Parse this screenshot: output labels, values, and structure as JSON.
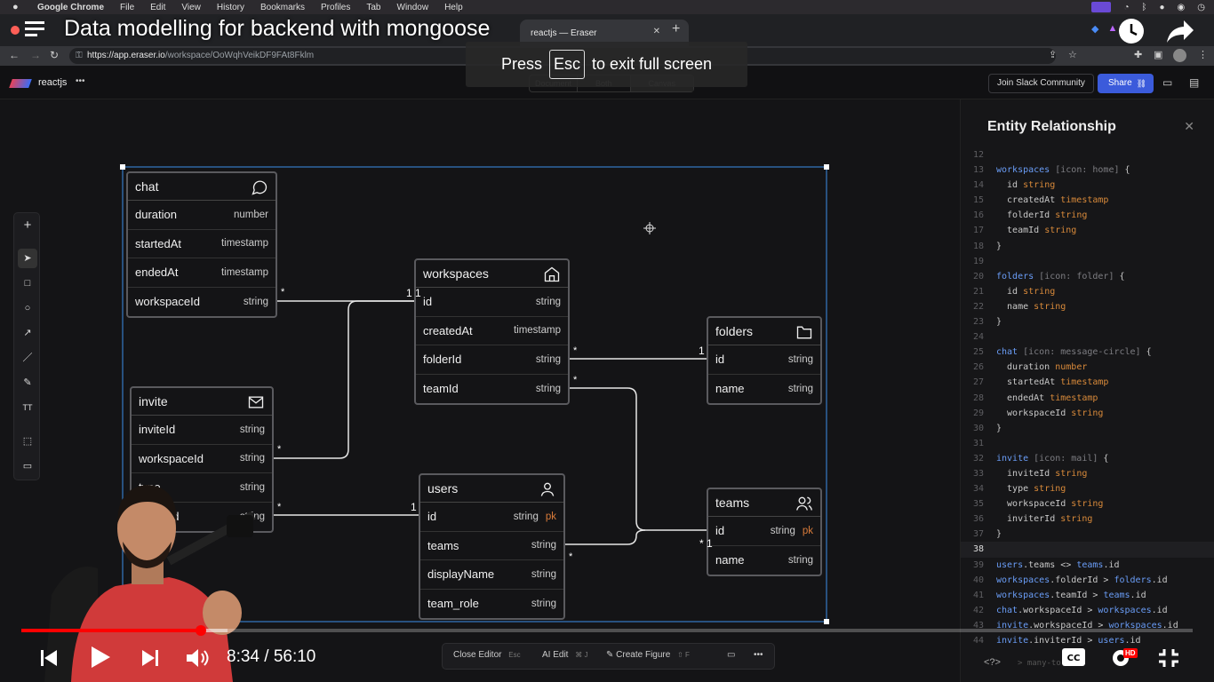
{
  "menubar": {
    "app": "Google Chrome",
    "items": [
      "File",
      "Edit",
      "View",
      "History",
      "Bookmarks",
      "Profiles",
      "Tab",
      "Window",
      "Help"
    ]
  },
  "video": {
    "title": "Data modelling for backend with mongoose",
    "esc_before": "Press",
    "esc_key": "Esc",
    "esc_after": "to exit full screen",
    "time_current": "8:34",
    "time_total": "56:10",
    "played_fraction": 0.153,
    "quality_badge": "HD"
  },
  "browser": {
    "tabs": [
      {
        "label": "reactjs — Eraser",
        "active": true
      }
    ],
    "url_host": "https://app.eraser.io",
    "url_path": "/workspace/OoWqhVeikDF9FAt8Fklm"
  },
  "app": {
    "workspace_name": "reactjs",
    "menu_dots": "•••",
    "views": [
      "Document",
      "Both",
      "Canvas"
    ],
    "slack_button": "Join Slack Community",
    "share_button": "Share"
  },
  "tables": {
    "chat": {
      "name": "chat",
      "icon": "message-circle-icon",
      "fields": [
        {
          "name": "duration",
          "type": "number"
        },
        {
          "name": "startedAt",
          "type": "timestamp"
        },
        {
          "name": "endedAt",
          "type": "timestamp"
        },
        {
          "name": "workspaceId",
          "type": "string"
        }
      ]
    },
    "workspaces": {
      "name": "workspaces",
      "icon": "home-icon",
      "fields": [
        {
          "name": "id",
          "type": "string"
        },
        {
          "name": "createdAt",
          "type": "timestamp"
        },
        {
          "name": "folderId",
          "type": "string"
        },
        {
          "name": "teamId",
          "type": "string"
        }
      ]
    },
    "folders": {
      "name": "folders",
      "icon": "folder-icon",
      "fields": [
        {
          "name": "id",
          "type": "string"
        },
        {
          "name": "name",
          "type": "string"
        }
      ]
    },
    "invite": {
      "name": "invite",
      "icon": "mail-icon",
      "fields": [
        {
          "name": "inviteId",
          "type": "string"
        },
        {
          "name": "workspaceId",
          "type": "string"
        },
        {
          "name": "type",
          "type": "string"
        },
        {
          "name": "inviterId",
          "type": "string"
        }
      ]
    },
    "users": {
      "name": "users",
      "icon": "user-icon",
      "fields": [
        {
          "name": "id",
          "type": "string",
          "pk": "pk"
        },
        {
          "name": "teams",
          "type": "string"
        },
        {
          "name": "displayName",
          "type": "string"
        },
        {
          "name": "team_role",
          "type": "string"
        }
      ]
    },
    "teams": {
      "name": "teams",
      "icon": "users-icon",
      "fields": [
        {
          "name": "id",
          "type": "string",
          "pk": "pk"
        },
        {
          "name": "name",
          "type": "string"
        }
      ]
    }
  },
  "cardinality": {
    "many": "*",
    "one": "1",
    "one_one": "1 1",
    "many_one": "* 1"
  },
  "panel": {
    "title": "Entity Relationship",
    "current_line": 38,
    "lines": [
      {
        "n": "12",
        "t": []
      },
      {
        "n": "13",
        "t": [
          [
            "ent",
            "workspaces"
          ],
          [
            "mut",
            " [icon: home] "
          ],
          [
            "f",
            "{"
          ]
        ]
      },
      {
        "n": "14",
        "t": [
          [
            "f",
            "  id "
          ],
          [
            "type",
            "string"
          ]
        ]
      },
      {
        "n": "15",
        "t": [
          [
            "f",
            "  createdAt "
          ],
          [
            "type",
            "timestamp"
          ]
        ]
      },
      {
        "n": "16",
        "t": [
          [
            "f",
            "  folderId "
          ],
          [
            "type",
            "string"
          ]
        ]
      },
      {
        "n": "17",
        "t": [
          [
            "f",
            "  teamId "
          ],
          [
            "type",
            "string"
          ]
        ]
      },
      {
        "n": "18",
        "t": [
          [
            "f",
            "}"
          ]
        ]
      },
      {
        "n": "19",
        "t": []
      },
      {
        "n": "20",
        "t": [
          [
            "ent",
            "folders"
          ],
          [
            "mut",
            " [icon: folder] "
          ],
          [
            "f",
            "{"
          ]
        ]
      },
      {
        "n": "21",
        "t": [
          [
            "f",
            "  id "
          ],
          [
            "type",
            "string"
          ]
        ]
      },
      {
        "n": "22",
        "t": [
          [
            "f",
            "  name "
          ],
          [
            "type",
            "string"
          ]
        ]
      },
      {
        "n": "23",
        "t": [
          [
            "f",
            "}"
          ]
        ]
      },
      {
        "n": "24",
        "t": []
      },
      {
        "n": "25",
        "t": [
          [
            "ent",
            "chat"
          ],
          [
            "mut",
            " [icon: message-circle] "
          ],
          [
            "f",
            "{"
          ]
        ]
      },
      {
        "n": "26",
        "t": [
          [
            "f",
            "  duration "
          ],
          [
            "type",
            "number"
          ]
        ]
      },
      {
        "n": "27",
        "t": [
          [
            "f",
            "  startedAt "
          ],
          [
            "type",
            "timestamp"
          ]
        ]
      },
      {
        "n": "28",
        "t": [
          [
            "f",
            "  endedAt "
          ],
          [
            "type",
            "timestamp"
          ]
        ]
      },
      {
        "n": "29",
        "t": [
          [
            "f",
            "  workspaceId "
          ],
          [
            "type",
            "string"
          ]
        ]
      },
      {
        "n": "30",
        "t": [
          [
            "f",
            "}"
          ]
        ]
      },
      {
        "n": "31",
        "t": []
      },
      {
        "n": "32",
        "t": [
          [
            "ent",
            "invite"
          ],
          [
            "mut",
            " [icon: mail] "
          ],
          [
            "f",
            "{"
          ]
        ]
      },
      {
        "n": "33",
        "t": [
          [
            "f",
            "  inviteId "
          ],
          [
            "type",
            "string"
          ]
        ]
      },
      {
        "n": "34",
        "t": [
          [
            "f",
            "  type "
          ],
          [
            "type",
            "string"
          ]
        ]
      },
      {
        "n": "35",
        "t": [
          [
            "f",
            "  workspaceId "
          ],
          [
            "type",
            "string"
          ]
        ]
      },
      {
        "n": "36",
        "t": [
          [
            "f",
            "  inviterId "
          ],
          [
            "type",
            "string"
          ]
        ]
      },
      {
        "n": "37",
        "t": [
          [
            "f",
            "}"
          ]
        ]
      },
      {
        "n": "38",
        "t": []
      },
      {
        "n": "39",
        "t": [
          [
            "ent",
            "users"
          ],
          [
            "f",
            ".teams <> "
          ],
          [
            "ent",
            "teams"
          ],
          [
            "f",
            ".id"
          ]
        ]
      },
      {
        "n": "40",
        "t": [
          [
            "ent",
            "workspaces"
          ],
          [
            "f",
            ".folderId > "
          ],
          [
            "ent",
            "folders"
          ],
          [
            "f",
            ".id"
          ]
        ]
      },
      {
        "n": "41",
        "t": [
          [
            "ent",
            "workspaces"
          ],
          [
            "f",
            ".teamId > "
          ],
          [
            "ent",
            "teams"
          ],
          [
            "f",
            ".id"
          ]
        ]
      },
      {
        "n": "42",
        "t": [
          [
            "ent",
            "chat"
          ],
          [
            "f",
            ".workspaceId > "
          ],
          [
            "ent",
            "workspaces"
          ],
          [
            "f",
            ".id"
          ]
        ]
      },
      {
        "n": "43",
        "t": [
          [
            "ent",
            "invite"
          ],
          [
            "f",
            ".workspaceId > "
          ],
          [
            "ent",
            "workspaces"
          ],
          [
            "f",
            ".id"
          ]
        ]
      },
      {
        "n": "44",
        "t": [
          [
            "ent",
            "invite"
          ],
          [
            "f",
            ".inviterId > "
          ],
          [
            "ent",
            "users"
          ],
          [
            "f",
            ".id"
          ]
        ]
      }
    ]
  },
  "bottombar": {
    "close_editor": "Close Editor",
    "close_editor_key": "Esc",
    "ai_edit": "AI Edit",
    "ai_edit_key": "⌘ J",
    "create_figure": "Create Figure",
    "create_figure_key": "⇧ F"
  },
  "panel_footer": {
    "code_toggle": "<?>",
    "hint": "> many-to-one"
  },
  "colors": {
    "accent": "#3b5bdb",
    "progress": "#ff0000",
    "pk": "#d97b3a",
    "entity": "#6a9df7"
  }
}
